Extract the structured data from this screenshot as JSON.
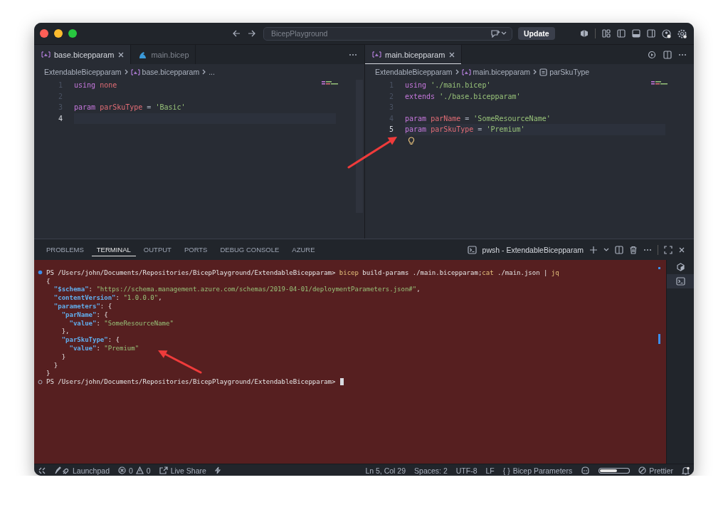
{
  "window": {
    "title": "BicepPlayground"
  },
  "titlebar": {
    "update_button": "Update"
  },
  "editor_groups": [
    {
      "focused": false,
      "tabs": [
        {
          "label": "base.bicepparam",
          "selected": true,
          "kind": "bicepparam"
        },
        {
          "label": "main.bicep",
          "selected": false,
          "kind": "bicep"
        }
      ],
      "breadcrumbs": [
        {
          "label": "ExtendableBicepparam",
          "kind": "folder"
        },
        {
          "label": "base.bicepparam",
          "kind": "bicepparam"
        },
        {
          "label": "...",
          "kind": "more"
        }
      ],
      "lines": [
        {
          "number": "1",
          "current": false,
          "tokens": [
            {
              "text": "using",
              "kind": "keyword"
            },
            {
              "text": " none",
              "kind": "name"
            }
          ]
        },
        {
          "number": "2",
          "current": false
        },
        {
          "number": "3",
          "current": false,
          "tokens": [
            {
              "text": "param",
              "kind": "keyword"
            },
            {
              "text": " parSkuType",
              "kind": "name"
            },
            {
              "text": " = ",
              "kind": "op"
            },
            {
              "text": "'Basic'",
              "kind": "string"
            }
          ]
        },
        {
          "number": "4",
          "current": true
        }
      ],
      "lightbulb": false
    },
    {
      "focused": true,
      "tabs": [
        {
          "label": "main.bicepparam",
          "selected": true,
          "kind": "bicepparam"
        }
      ],
      "breadcrumbs": [
        {
          "label": "ExtendableBicepparam",
          "kind": "folder"
        },
        {
          "label": "main.bicepparam",
          "kind": "bicepparam"
        },
        {
          "label": "parSkuType",
          "kind": "symbol"
        }
      ],
      "lines": [
        {
          "number": "1",
          "current": false,
          "tokens": [
            {
              "text": "using",
              "kind": "keyword"
            },
            {
              "text": " './main.bicep'",
              "kind": "string"
            }
          ]
        },
        {
          "number": "2",
          "current": false,
          "tokens": [
            {
              "text": "extends",
              "kind": "keyword"
            },
            {
              "text": " './base.bicepparam'",
              "kind": "string"
            }
          ]
        },
        {
          "number": "3",
          "current": false
        },
        {
          "number": "4",
          "current": false,
          "tokens": [
            {
              "text": "param",
              "kind": "keyword"
            },
            {
              "text": " parName",
              "kind": "name"
            },
            {
              "text": " = ",
              "kind": "op"
            },
            {
              "text": "'SomeResourceName'",
              "kind": "string"
            }
          ]
        },
        {
          "number": "5",
          "current": true,
          "tokens": [
            {
              "text": "param",
              "kind": "keyword"
            },
            {
              "text": " parSkuType",
              "kind": "name"
            },
            {
              "text": " = ",
              "kind": "op"
            },
            {
              "text": "'Premium'",
              "kind": "string"
            }
          ]
        }
      ],
      "lightbulb": true
    }
  ],
  "panel": {
    "tabs": [
      {
        "label": "PROBLEMS",
        "selected": false
      },
      {
        "label": "TERMINAL",
        "selected": true
      },
      {
        "label": "OUTPUT",
        "selected": false
      },
      {
        "label": "PORTS",
        "selected": false
      },
      {
        "label": "DEBUG CONSOLE",
        "selected": false
      },
      {
        "label": "AZURE",
        "selected": false
      }
    ],
    "terminal_title": "pwsh - ExtendableBicepparam",
    "terminal_lines": [
      {
        "kind": "success",
        "tokens": [
          {
            "text": "PS /Users/john/Documents/Repositories/BicepPlayground/ExtendableBicepparam> ",
            "kind": "plain"
          },
          {
            "text": "bicep",
            "kind": "command"
          },
          {
            "text": " build-params ./main.bicepparam;",
            "kind": "plain"
          },
          {
            "text": "cat",
            "kind": "command"
          },
          {
            "text": " ./main.json | ",
            "kind": "plain"
          },
          {
            "text": "jq",
            "kind": "command"
          }
        ]
      },
      {
        "kind": "output",
        "tokens": [
          {
            "text": "{",
            "kind": "plain"
          }
        ]
      },
      {
        "kind": "output",
        "tokens": [
          {
            "text": "  \"$schema\"",
            "kind": "key"
          },
          {
            "text": ": ",
            "kind": "plain"
          },
          {
            "text": "\"https://schema.management.azure.com/schemas/2019-04-01/deploymentParameters.json#\"",
            "kind": "string"
          },
          {
            "text": ",",
            "kind": "plain"
          }
        ]
      },
      {
        "kind": "output",
        "tokens": [
          {
            "text": "  \"contentVersion\"",
            "kind": "key"
          },
          {
            "text": ": ",
            "kind": "plain"
          },
          {
            "text": "\"1.0.0.0\"",
            "kind": "string"
          },
          {
            "text": ",",
            "kind": "plain"
          }
        ]
      },
      {
        "kind": "output",
        "tokens": [
          {
            "text": "  \"parameters\"",
            "kind": "key"
          },
          {
            "text": ": {",
            "kind": "plain"
          }
        ]
      },
      {
        "kind": "output",
        "tokens": [
          {
            "text": "    \"parName\"",
            "kind": "key"
          },
          {
            "text": ": {",
            "kind": "plain"
          }
        ]
      },
      {
        "kind": "output",
        "tokens": [
          {
            "text": "      \"value\"",
            "kind": "key"
          },
          {
            "text": ": ",
            "kind": "plain"
          },
          {
            "text": "\"SomeResourceName\"",
            "kind": "string"
          }
        ]
      },
      {
        "kind": "output",
        "tokens": [
          {
            "text": "    },",
            "kind": "plain"
          }
        ]
      },
      {
        "kind": "output",
        "tokens": [
          {
            "text": "    \"parSkuType\"",
            "kind": "key"
          },
          {
            "text": ": {",
            "kind": "plain"
          }
        ]
      },
      {
        "kind": "output",
        "tokens": [
          {
            "text": "      \"value\"",
            "kind": "key"
          },
          {
            "text": ": ",
            "kind": "plain"
          },
          {
            "text": "\"Premium\"",
            "kind": "string"
          }
        ]
      },
      {
        "kind": "output",
        "tokens": [
          {
            "text": "    }",
            "kind": "plain"
          }
        ]
      },
      {
        "kind": "output",
        "tokens": [
          {
            "text": "  }",
            "kind": "plain"
          }
        ]
      },
      {
        "kind": "output",
        "tokens": [
          {
            "text": "}",
            "kind": "plain"
          }
        ]
      },
      {
        "kind": "idle",
        "cursor": true,
        "tokens": [
          {
            "text": "PS /Users/john/Documents/Repositories/BicepPlayground/ExtendableBicepparam> ",
            "kind": "plain"
          }
        ]
      }
    ]
  },
  "annotations": [
    {
      "kind": "arrow"
    },
    {
      "kind": "arrow"
    }
  ],
  "status_bar": {
    "left": [
      {
        "kind": "remote"
      },
      {
        "kind": "launchpad",
        "label": "Launchpad"
      },
      {
        "kind": "problems",
        "errors": "0",
        "warnings": "0"
      },
      {
        "kind": "liveshare",
        "label": "Live Share"
      },
      {
        "kind": "lightning"
      }
    ],
    "right": [
      {
        "kind": "text",
        "label": "Ln 5, Col 29"
      },
      {
        "kind": "text",
        "label": "Spaces: 2"
      },
      {
        "kind": "text",
        "label": "UTF-8"
      },
      {
        "kind": "text",
        "label": "LF"
      },
      {
        "kind": "language",
        "braces": "{ }",
        "label": "Bicep Parameters"
      },
      {
        "kind": "copilot"
      },
      {
        "kind": "pill"
      },
      {
        "kind": "prettier",
        "label": "Prettier"
      },
      {
        "kind": "bell"
      }
    ]
  }
}
